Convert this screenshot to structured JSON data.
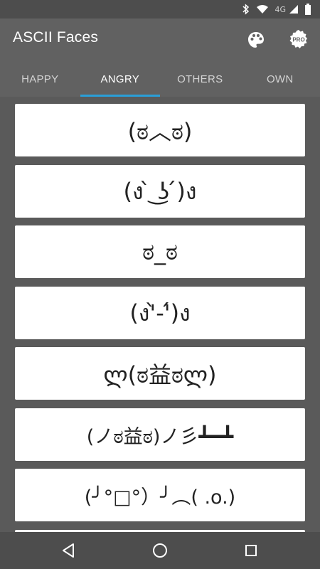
{
  "status_bar": {
    "network_label": "4G",
    "icons": [
      "bluetooth-icon",
      "wifi-icon",
      "cell-signal-icon",
      "battery-icon"
    ]
  },
  "app_bar": {
    "title": "ASCII Faces",
    "actions": [
      "palette-icon",
      "pro-icon"
    ],
    "pro_badge_text": "PRO"
  },
  "tabs": [
    {
      "label": "HAPPY",
      "active": false
    },
    {
      "label": "ANGRY",
      "active": true
    },
    {
      "label": "OTHERS",
      "active": false
    },
    {
      "label": "OWN",
      "active": false
    }
  ],
  "faces": [
    "(ಠ︿ಠ)",
    "(ง ̀ ͜ʖ ́)ง",
    "ಠ_ಠ",
    "(ง'̀-'́)ง",
    "ლ(ಠ益ಠლ)",
    "(ノಠ益ಠ)ノ彡┻━┻",
    "(╯°□°）╯︵( .o.)",
    ""
  ],
  "nav_bar": {
    "buttons": [
      "back-icon",
      "home-icon",
      "recents-icon"
    ]
  },
  "colors": {
    "app_bar": "#616161",
    "status_bar": "#4d4d4d",
    "background": "#5a5a5a",
    "tab_indicator": "#2a9fd8",
    "card": "#ffffff"
  }
}
